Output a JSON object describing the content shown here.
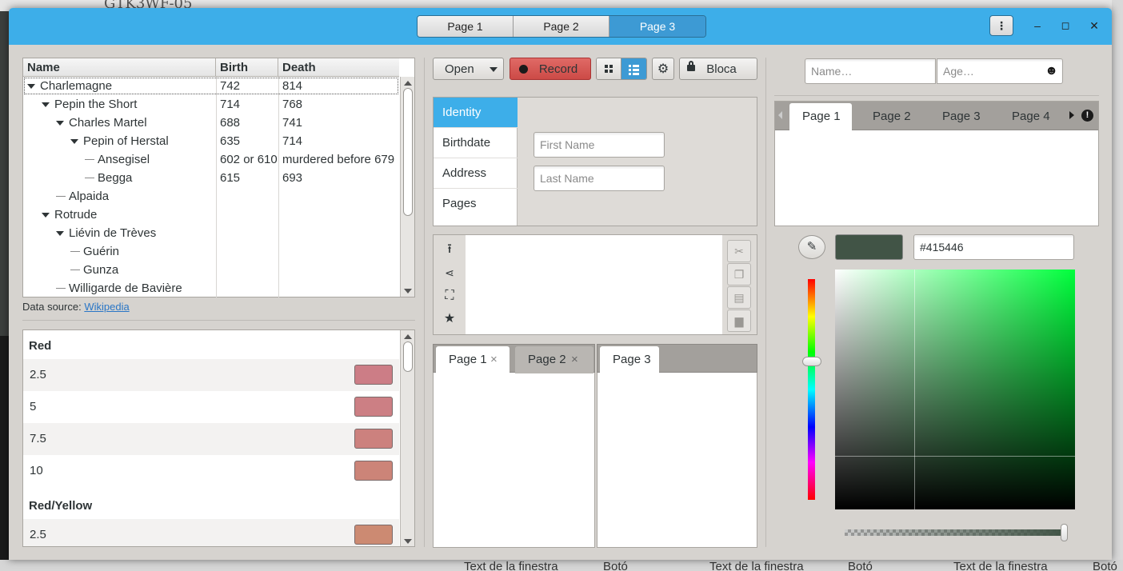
{
  "background": {
    "title_fragment": "GTK3WF-05",
    "bottom_texts": [
      "Text de la finestra",
      "Botó",
      "Text de la finestra",
      "Botó",
      "Text de la finestra",
      "Botó"
    ]
  },
  "headerbar": {
    "switcher": [
      "Page 1",
      "Page 2",
      "Page 3"
    ],
    "active_page": "Page 3",
    "menu_icon": "⋮",
    "minimize": "‒",
    "maximize": "◻",
    "close": "✕"
  },
  "tree": {
    "columns": [
      "Name",
      "Birth",
      "Death"
    ],
    "rows": [
      {
        "name": "Charlemagne",
        "birth": "742",
        "death": "814"
      },
      {
        "name": "Pepin the Short",
        "birth": "714",
        "death": "768"
      },
      {
        "name": "Charles Martel",
        "birth": "688",
        "death": "741"
      },
      {
        "name": "Pepin of Herstal",
        "birth": "635",
        "death": "714"
      },
      {
        "name": "Ansegisel",
        "birth": "602 or 610",
        "death": "murdered before 679"
      },
      {
        "name": "Begga",
        "birth": "615",
        "death": "693"
      },
      {
        "name": "Alpaida",
        "birth": "",
        "death": ""
      },
      {
        "name": "Rotrude",
        "birth": "",
        "death": ""
      },
      {
        "name": "Liévin de Trèves",
        "birth": "",
        "death": ""
      },
      {
        "name": "Guérin",
        "birth": "",
        "death": ""
      },
      {
        "name": "Gunza",
        "birth": "",
        "death": ""
      },
      {
        "name": "Willigarde de Bavière",
        "birth": "",
        "death": ""
      }
    ],
    "data_source_label": "Data source:",
    "data_source_link": "Wikipedia"
  },
  "colors_list": {
    "groups": [
      {
        "heading": "Red",
        "items": [
          {
            "label": "2.5",
            "color": "#cc7d86"
          },
          {
            "label": "5",
            "color": "#cc7f84"
          },
          {
            "label": "7.5",
            "color": "#cc817e"
          },
          {
            "label": "10",
            "color": "#cc8478"
          }
        ]
      },
      {
        "heading": "Red/Yellow",
        "items": [
          {
            "label": "2.5",
            "color": "#cc8a72"
          }
        ]
      }
    ]
  },
  "toolbar": {
    "open_label": "Open",
    "record_label": "Record",
    "lock_label": "Bloca",
    "record_color": "#d9534f"
  },
  "stack_sidebar": {
    "items": [
      "Identity",
      "Birthdate",
      "Address",
      "Pages"
    ],
    "selected": "Identity",
    "first_name_placeholder": "First Name",
    "last_name_placeholder": "Last Name"
  },
  "notebook_bottom": {
    "left_tabs": [
      "Page 1",
      "Page 2"
    ],
    "right_tabs": [
      "Page 3"
    ],
    "close_glyph": "×"
  },
  "right_panel": {
    "name_placeholder": "Name…",
    "age_placeholder": "Age…",
    "tabs": [
      "Page 1",
      "Page 2",
      "Page 3",
      "Page 4"
    ],
    "color_hex": "#415446",
    "picked_color": "#415446",
    "hue_color": "#00ff3c"
  }
}
